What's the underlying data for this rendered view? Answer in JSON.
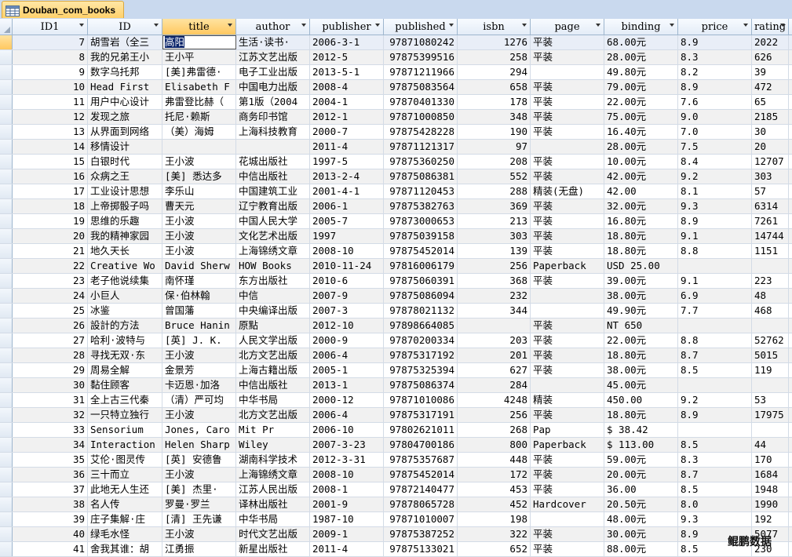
{
  "table_name": "Douban_com_books",
  "columns": [
    "ID1",
    "ID",
    "title",
    "author",
    "publisher",
    "published",
    "isbn",
    "page",
    "binding",
    "price",
    "rating"
  ],
  "selected_column": "title",
  "rows": [
    [
      "7",
      "胡雪岩（全三",
      "高阳",
      "生活·读书·",
      "2006-3-1",
      "97871080242",
      "1276",
      "平装",
      "68.00元",
      "8.9",
      "2022"
    ],
    [
      "8",
      "我的兄弟王小",
      "王小平",
      "江苏文艺出版",
      "2012-5",
      "97875399516",
      "258",
      "平装",
      "28.00元",
      "8.3",
      "626"
    ],
    [
      "9",
      "数字乌托邦",
      "[美]弗雷德·",
      "电子工业出版",
      "2013-5-1",
      "97871211966",
      "294",
      "",
      "49.80元",
      "8.2",
      "39"
    ],
    [
      "10",
      "Head First",
      "Elisabeth F",
      "中国电力出版",
      "2008-4",
      "97875083564",
      "658",
      "平装",
      "79.00元",
      "8.9",
      "472"
    ],
    [
      "11",
      "用户中心设计",
      "弗雷登比赫（",
      "第1版（2004",
      "2004-1",
      "97870401330",
      "178",
      "平装",
      "22.00元",
      "7.6",
      "65"
    ],
    [
      "12",
      "发现之旅",
      "托尼·赖斯",
      "商务印书馆",
      "2012-1",
      "97871000850",
      "348",
      "平装",
      "75.00元",
      "9.0",
      "2185"
    ],
    [
      "13",
      "从界面到网络",
      "（美）海姆",
      "上海科技教育",
      "2000-7",
      "97875428228",
      "190",
      "平装",
      "16.40元",
      "7.0",
      "30"
    ],
    [
      "14",
      "移情设计",
      "",
      "",
      "2011-4",
      "97871121317",
      "97",
      "",
      "28.00元",
      "7.5",
      "20"
    ],
    [
      "15",
      "白银时代",
      "王小波",
      "花城出版社",
      "1997-5",
      "97875360250",
      "208",
      "平装",
      "10.00元",
      "8.4",
      "12707"
    ],
    [
      "16",
      "众病之王",
      "[美] 悉达多",
      "中信出版社",
      "2013-2-4",
      "97875086381",
      "552",
      "平装",
      "42.00元",
      "9.2",
      "303"
    ],
    [
      "17",
      "工业设计思想",
      "李乐山",
      "中国建筑工业",
      "2001-4-1",
      "97871120453",
      "288",
      "精装(无盘)",
      "42.00",
      "8.1",
      "57"
    ],
    [
      "18",
      "上帝掷骰子吗",
      "曹天元",
      "辽宁教育出版",
      "2006-1",
      "97875382763",
      "369",
      "平装",
      "32.00元",
      "9.3",
      "6314"
    ],
    [
      "19",
      "思维的乐趣",
      "王小波",
      "中国人民大学",
      "2005-7",
      "97873000653",
      "213",
      "平装",
      "16.80元",
      "8.9",
      "7261"
    ],
    [
      "20",
      "我的精神家园",
      "王小波",
      "文化艺术出版",
      "1997",
      "97875039158",
      "303",
      "平装",
      "18.80元",
      "9.1",
      "14744"
    ],
    [
      "21",
      "地久天长",
      "王小波",
      "上海锦绣文章",
      "2008-10",
      "97875452014",
      "139",
      "平装",
      "18.80元",
      "8.8",
      "1151"
    ],
    [
      "22",
      "Creative Wo",
      "David Sherw",
      "HOW Books",
      "2010-11-24",
      "97816006179",
      "256",
      "Paperback",
      "USD 25.00",
      "",
      ""
    ],
    [
      "23",
      "老子他说续集",
      "南怀瑾",
      "东方出版社",
      "2010-6",
      "97875060391",
      "368",
      "平装",
      "39.00元",
      "9.1",
      "223"
    ],
    [
      "24",
      "小巨人",
      "保·伯林翰",
      "中信",
      "2007-9",
      "97875086094",
      "232",
      "",
      "38.00元",
      "6.9",
      "48"
    ],
    [
      "25",
      "冰鉴",
      "曾国藩",
      "中央编译出版",
      "2007-3",
      "97878021132",
      "344",
      "",
      "49.90元",
      "7.7",
      "468"
    ],
    [
      "26",
      "設計的方法",
      "Bruce Hanin",
      "原點",
      "2012-10",
      "97898664085",
      "",
      "平装",
      "NT 650",
      "",
      ""
    ],
    [
      "27",
      "哈利·波特与",
      "[英] J. K.",
      "人民文学出版",
      "2000-9",
      "97870200334",
      "203",
      "平装",
      "22.00元",
      "8.8",
      "52762"
    ],
    [
      "28",
      "寻找无双·东",
      "王小波",
      "北方文艺出版",
      "2006-4",
      "97875317192",
      "201",
      "平装",
      "18.80元",
      "8.7",
      "5015"
    ],
    [
      "29",
      "周易全解",
      "金景芳",
      "上海古籍出版",
      "2005-1",
      "97875325394",
      "627",
      "平装",
      "38.00元",
      "8.5",
      "119"
    ],
    [
      "30",
      "黏住顾客",
      "卡迈恩·加洛",
      "中信出版社",
      "2013-1",
      "97875086374",
      "284",
      "",
      "45.00元",
      "",
      ""
    ],
    [
      "31",
      "全上古三代秦",
      "（清）严可均",
      "中华书局",
      "2000-12",
      "97871010086",
      "4248",
      "精装",
      "450.00",
      "9.2",
      "53"
    ],
    [
      "32",
      "一只特立独行",
      "王小波",
      "北方文艺出版",
      "2006-4",
      "97875317191",
      "256",
      "平装",
      "18.80元",
      "8.9",
      "17975"
    ],
    [
      "33",
      "Sensorium",
      "Jones, Caro",
      "Mit Pr",
      "2006-10",
      "97802621011",
      "268",
      "Pap",
      "$ 38.42",
      "",
      ""
    ],
    [
      "34",
      "Interaction",
      "Helen Sharp",
      "Wiley",
      "2007-3-23",
      "97804700186",
      "800",
      "Paperback",
      "$ 113.00",
      "8.5",
      "44"
    ],
    [
      "35",
      "艾伦·图灵传",
      "[英] 安德鲁",
      "湖南科学技术",
      "2012-3-31",
      "97875357687",
      "448",
      "平装",
      "59.00元",
      "8.3",
      "170"
    ],
    [
      "36",
      "三十而立",
      "王小波",
      "上海锦绣文章",
      "2008-10",
      "97875452014",
      "172",
      "平装",
      "20.00元",
      "8.7",
      "1684"
    ],
    [
      "37",
      "此地无人生还",
      "[美] 杰里·",
      "江苏人民出版",
      "2008-1",
      "97872140477",
      "453",
      "平装",
      "36.00",
      "8.5",
      "1948"
    ],
    [
      "38",
      "名人传",
      "罗曼·罗兰",
      "译林出版社",
      "2001-9",
      "97878065728",
      "452",
      "Hardcover",
      "20.50元",
      "8.0",
      "1990"
    ],
    [
      "39",
      "庄子集解·庄",
      "[清] 王先谦",
      "中华书局",
      "1987-10",
      "97871010007",
      "198",
      "",
      "48.00元",
      "9.3",
      "192"
    ],
    [
      "40",
      "绿毛水怪",
      "王小波",
      "时代文艺出版",
      "2009-1",
      "97875387252",
      "322",
      "平装",
      "30.00元",
      "8.9",
      "5077"
    ],
    [
      "41",
      "舍我其谁：胡",
      "江勇振",
      "新星出版社",
      "2011-4",
      "97875133021",
      "652",
      "平装",
      "88.00元",
      "8.5",
      "230"
    ]
  ],
  "watermark": "鲲鹏数据",
  "colors": {
    "tab_bg": "#ffd06a",
    "header_bg": "#e4ecf7",
    "grid_line": "#d3dbe6",
    "selected_header": "#ffc860"
  }
}
